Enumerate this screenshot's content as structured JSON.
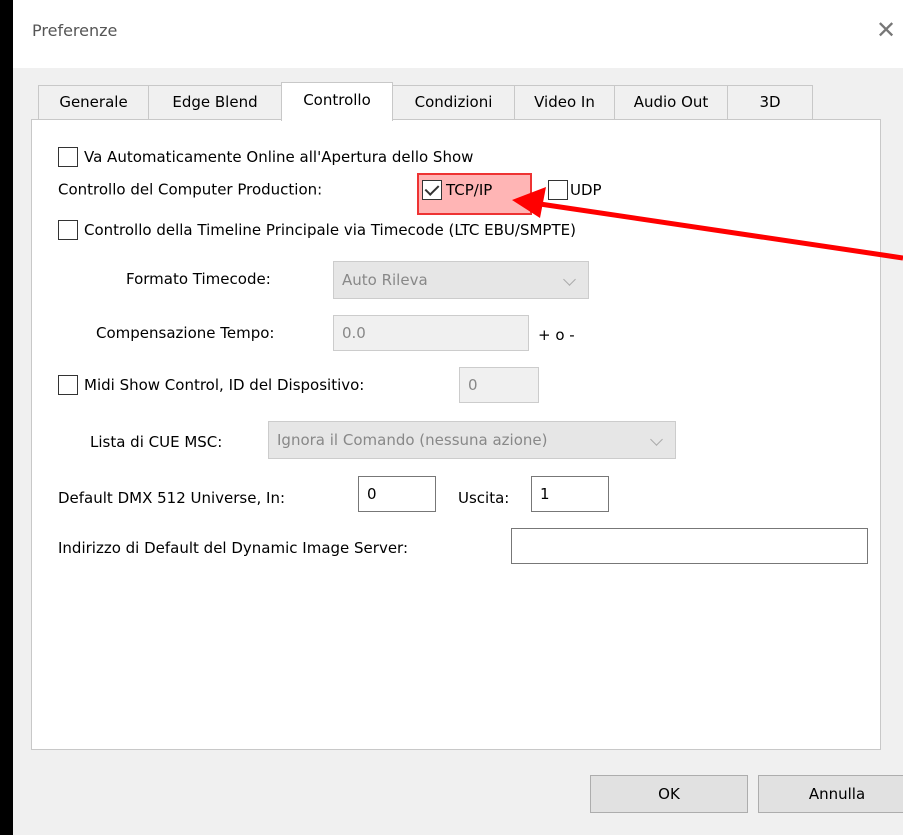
{
  "window": {
    "title": "Preferenze",
    "close_glyph": "✕"
  },
  "tabs": [
    {
      "label": "Generale"
    },
    {
      "label": "Edge Blend"
    },
    {
      "label": "Controllo",
      "active": true
    },
    {
      "label": "Condizioni"
    },
    {
      "label": "Video In"
    },
    {
      "label": "Audio Out"
    },
    {
      "label": "3D"
    }
  ],
  "controllo": {
    "auto_online": {
      "label": "Va Automaticamente Online all'Apertura dello Show",
      "checked": false
    },
    "computer_production": {
      "label": "Controllo del Computer Production:",
      "tcpip": {
        "label": "TCP/IP",
        "checked": true
      },
      "udp": {
        "label": "UDP",
        "checked": false
      }
    },
    "timecode_control": {
      "label": "Controllo della Timeline Principale via Timecode (LTC EBU/SMPTE)",
      "checked": false
    },
    "timecode_format": {
      "label": "Formato Timecode:",
      "value": "Auto Rileva"
    },
    "time_compensation": {
      "label": "Compensazione Tempo:",
      "value": "0.0",
      "suffix": "+ o -"
    },
    "midi_show_control": {
      "label": "Midi Show Control, ID del Dispositivo:",
      "checked": false,
      "value": "0"
    },
    "msc_cue_list": {
      "label": "Lista di CUE MSC:",
      "value": "Ignora il Comando (nessuna azione)"
    },
    "dmx": {
      "label": "Default DMX 512 Universe, In:",
      "in_value": "0",
      "out_label": "Uscita:",
      "out_value": "1"
    },
    "image_server": {
      "label": "Indirizzo di Default del Dynamic Image Server:",
      "value": ""
    }
  },
  "buttons": {
    "ok": "OK",
    "cancel": "Annulla"
  },
  "annotation": {
    "color": "#ff0000",
    "highlight_color": "#ff7878"
  }
}
